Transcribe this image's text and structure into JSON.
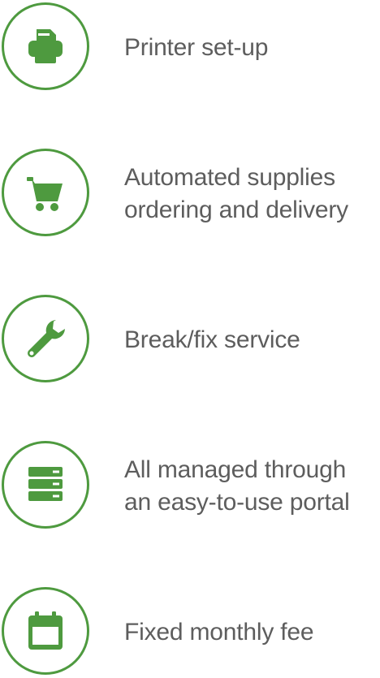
{
  "theme": {
    "accent": "#4e9a3f",
    "text": "#5d5d5d",
    "background": "#ffffff"
  },
  "features": [
    {
      "icon": "printer-icon",
      "label": "Printer set-up"
    },
    {
      "icon": "shopping-cart-icon",
      "label": "Automated supplies\nordering and delivery"
    },
    {
      "icon": "wrench-icon",
      "label": "Break/fix service"
    },
    {
      "icon": "server-icon",
      "label": "All managed through\nan easy-to-use portal"
    },
    {
      "icon": "calendar-icon",
      "label": "Fixed monthly fee"
    }
  ]
}
